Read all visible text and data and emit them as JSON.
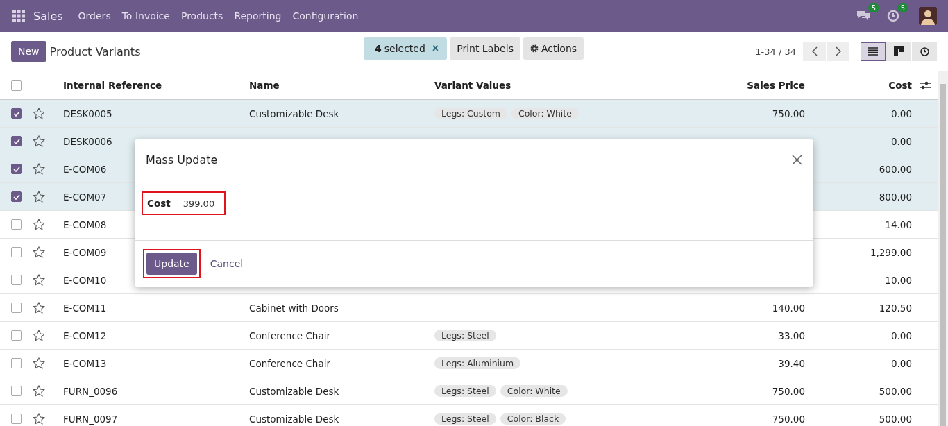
{
  "navbar": {
    "app": "Sales",
    "menu": [
      "Orders",
      "To Invoice",
      "Products",
      "Reporting",
      "Configuration"
    ],
    "messages_count": "5",
    "activities_count": "5"
  },
  "control_panel": {
    "new_button": "New",
    "title": "Product Variants",
    "selection": {
      "count": "4",
      "label": "selected",
      "clear": "×"
    },
    "print_button": "Print Labels",
    "actions_button": "Actions",
    "pager": "1-34 / 34",
    "views": [
      {
        "kind": "list",
        "selected": true
      },
      {
        "kind": "kanban",
        "selected": false
      },
      {
        "kind": "activity",
        "selected": false
      }
    ]
  },
  "table": {
    "all_checked": false,
    "columns": [
      "Internal Reference",
      "Name",
      "Variant Values",
      "Sales Price",
      "Cost"
    ],
    "rows": [
      {
        "checked": true,
        "ref": "DESK0005",
        "name": "Customizable Desk",
        "variants": [
          "Legs: Custom",
          "Color: White"
        ],
        "price": "750.00",
        "cost": "0.00"
      },
      {
        "checked": true,
        "ref": "DESK0006",
        "cost": "0.00"
      },
      {
        "checked": true,
        "ref": "E-COM06",
        "cost": "600.00"
      },
      {
        "checked": true,
        "ref": "E-COM07",
        "cost": "800.00"
      },
      {
        "checked": false,
        "ref": "E-COM08",
        "cost": "14.00"
      },
      {
        "checked": false,
        "ref": "E-COM09",
        "cost": "1,299.00"
      },
      {
        "checked": false,
        "ref": "E-COM10",
        "cost": "10.00"
      },
      {
        "checked": false,
        "ref": "E-COM11",
        "name": "Cabinet with Doors",
        "variants": [],
        "price": "140.00",
        "cost": "120.50"
      },
      {
        "checked": false,
        "ref": "E-COM12",
        "name": "Conference Chair",
        "variants": [
          "Legs: Steel"
        ],
        "price": "33.00",
        "cost": "0.00"
      },
      {
        "checked": false,
        "ref": "E-COM13",
        "name": "Conference Chair",
        "variants": [
          "Legs: Aluminium"
        ],
        "price": "39.40",
        "cost": "0.00"
      },
      {
        "checked": false,
        "ref": "FURN_0096",
        "name": "Customizable Desk",
        "variants": [
          "Legs: Steel",
          "Color: White"
        ],
        "price": "750.00",
        "cost": "500.00"
      },
      {
        "checked": false,
        "ref": "FURN_0097",
        "name": "Customizable Desk",
        "variants": [
          "Legs: Steel",
          "Color: Black"
        ],
        "price": "750.00",
        "cost": "500.00"
      }
    ]
  },
  "dialog": {
    "title": "Mass Update",
    "field": {
      "label": "Cost",
      "value": "399.00",
      "highlighted": true
    },
    "update_button": {
      "label": "Update",
      "highlighted": true
    },
    "cancel_link": "Cancel"
  }
}
